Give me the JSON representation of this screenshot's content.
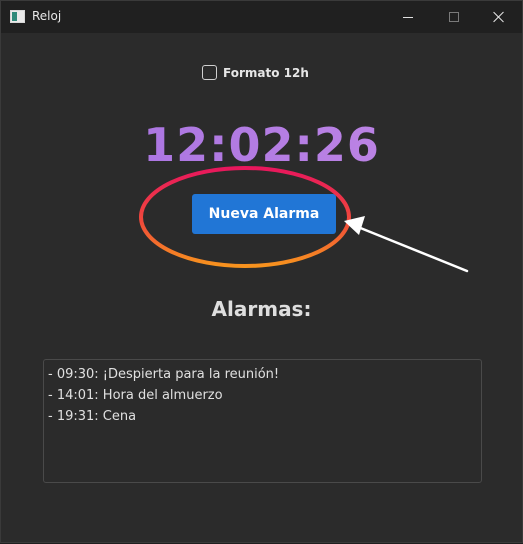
{
  "window": {
    "title": "Reloj"
  },
  "settings": {
    "format_label": "Formato 12h",
    "format_12h_checked": false
  },
  "clock": {
    "time": "12:02:26"
  },
  "actions": {
    "new_alarm_label": "Nueva Alarma"
  },
  "alarms": {
    "heading": "Alarmas:",
    "items": [
      "- 09:30: ¡Despierta para la reunión!",
      "- 14:01: Hora del almuerzo",
      "- 19:31: Cena"
    ]
  },
  "colors": {
    "background": "#2b2b2b",
    "titlebar": "#202020",
    "clock_gradient_start": "#a36fe0",
    "clock_gradient_end": "#c48ae6",
    "button": "#2176d6",
    "annotation_ring_start": "#e8175d",
    "annotation_ring_end": "#f7931e",
    "annotation_arrow": "#ffffff"
  },
  "icons": {
    "app": "clock-app-icon",
    "minimize": "minimize-icon",
    "maximize": "maximize-icon",
    "close": "close-icon"
  }
}
